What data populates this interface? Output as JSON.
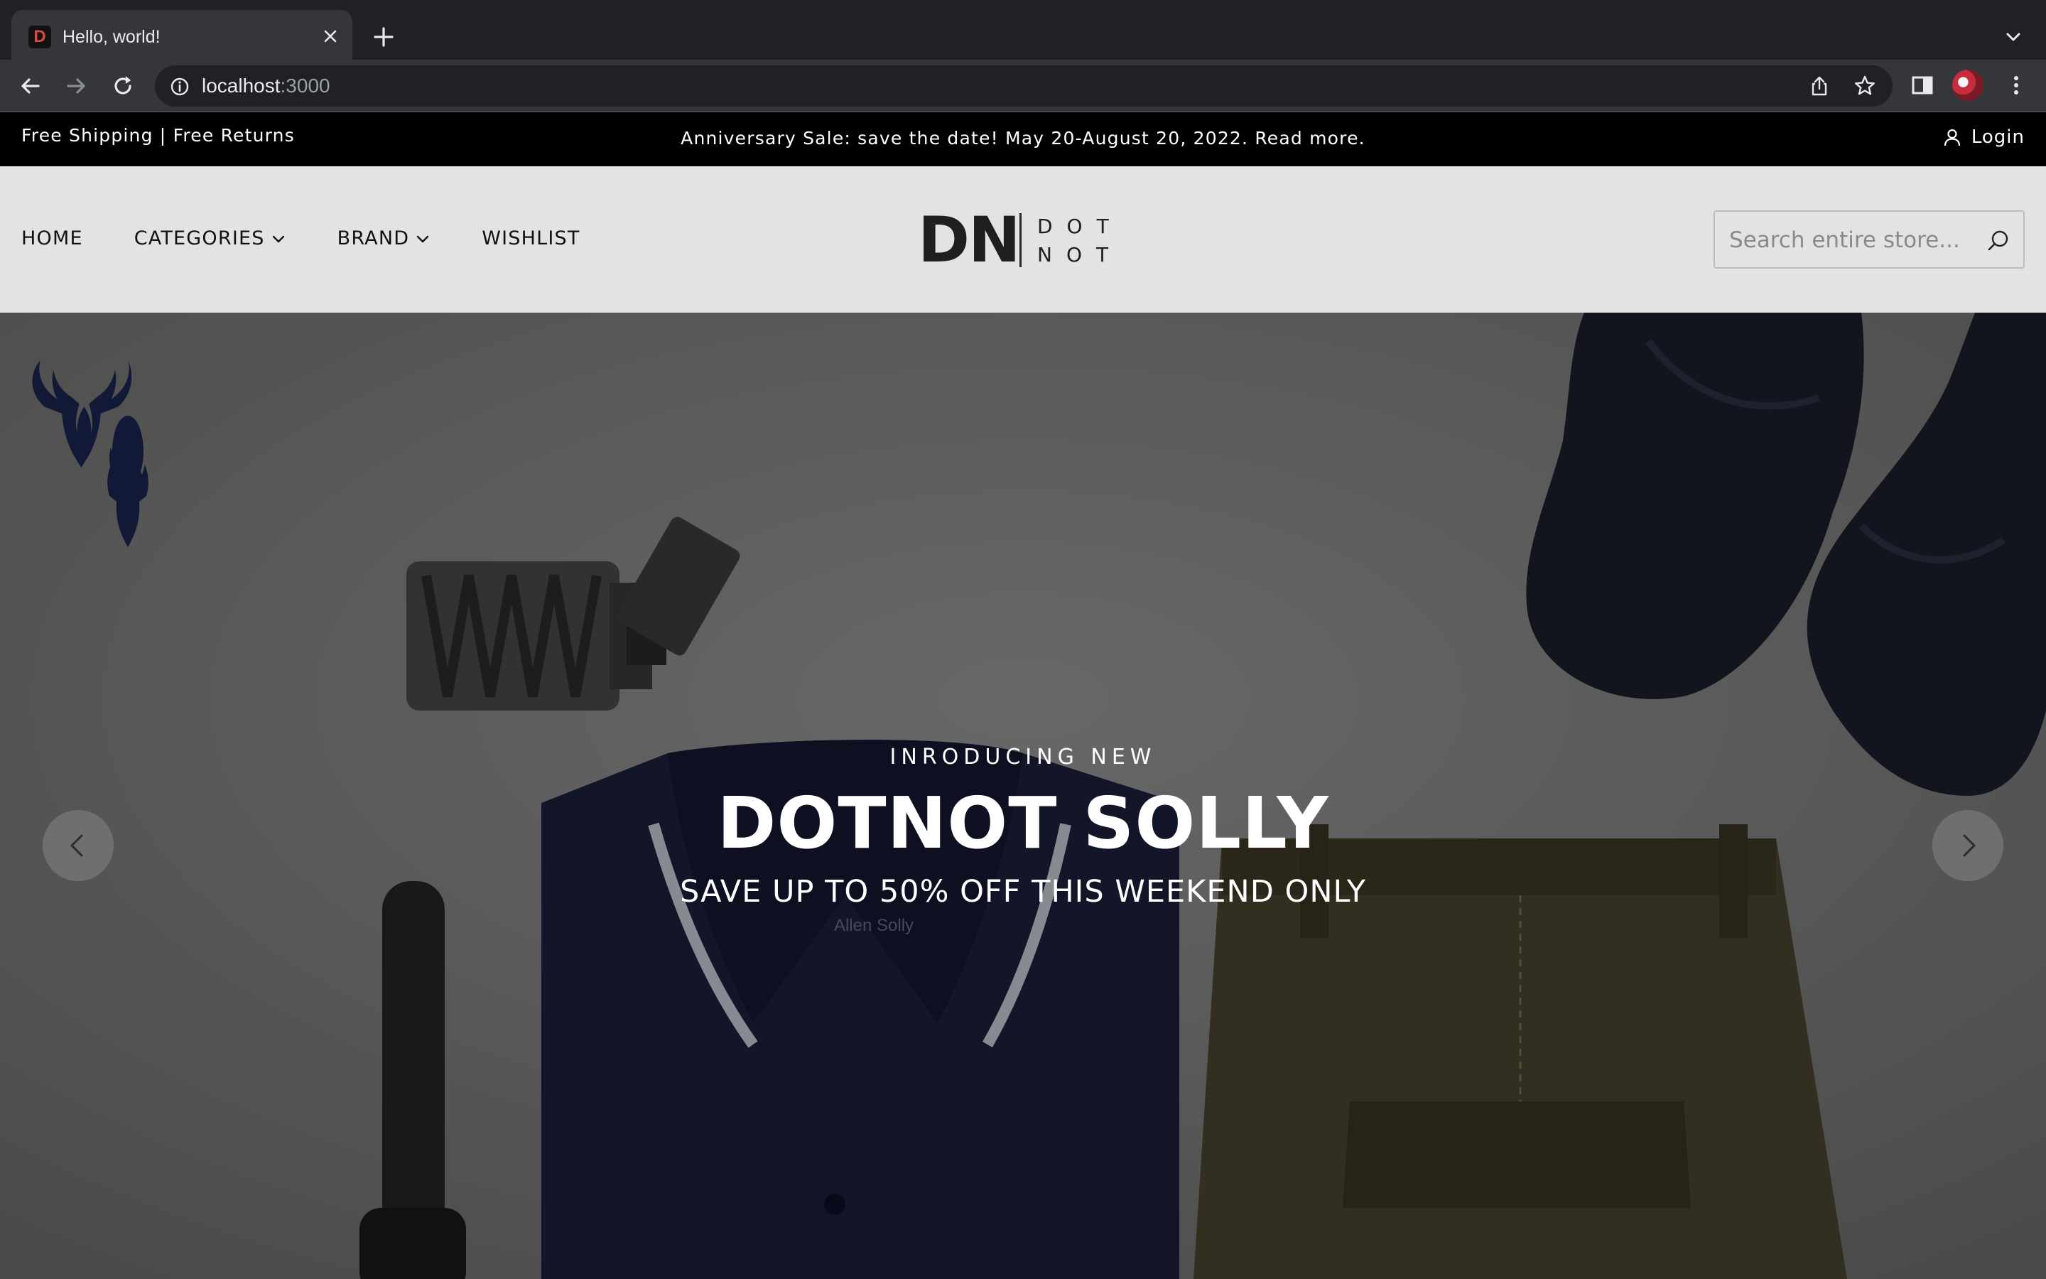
{
  "browser": {
    "tab_title": "Hello, world!",
    "tab_favicon_letter": "D",
    "url_host": "localhost",
    "url_port": ":3000"
  },
  "announcement": {
    "left": "Free Shipping | Free Returns",
    "center": "Anniversary Sale: save the date! May 20-August 20, 2022.",
    "read_more": "Read more.",
    "login": "Login"
  },
  "nav": {
    "items": [
      {
        "label": "HOME",
        "dropdown": false
      },
      {
        "label": "CATEGORIES",
        "dropdown": true
      },
      {
        "label": "BRAND",
        "dropdown": true
      },
      {
        "label": "WISHLIST",
        "dropdown": false
      }
    ]
  },
  "logo": {
    "mark": "DN",
    "line1": "DOT",
    "line2": "NOT"
  },
  "search": {
    "placeholder": "Search entire store...",
    "value": ""
  },
  "hero": {
    "eyebrow": "INRODUCING NEW",
    "title": "DOTNOT SOLLY",
    "subtitle": "SAVE UP TO 50% OFF THIS WEEKEND ONLY",
    "shirt_label": "Allen Solly"
  },
  "colors": {
    "chrome_dark": "#202124",
    "chrome_toolbar": "#35363a",
    "announce_bg": "#000000",
    "header_bg": "#e3e3e3",
    "hero_bg": "#3a3a3a",
    "shirt_navy": "#1c1f3d",
    "pants_olive": "#4a4630"
  },
  "icons": {
    "tab_close": "close-icon",
    "new_tab": "plus-icon",
    "back": "arrow-left-icon",
    "forward": "arrow-right-icon",
    "reload": "reload-icon",
    "site_info": "info-icon",
    "share": "share-icon",
    "bookmark": "star-icon",
    "side_panel": "side-panel-icon",
    "menu": "kebab-menu-icon",
    "login": "user-icon",
    "search": "search-icon",
    "prev": "chevron-left-icon",
    "next": "chevron-right-icon"
  }
}
